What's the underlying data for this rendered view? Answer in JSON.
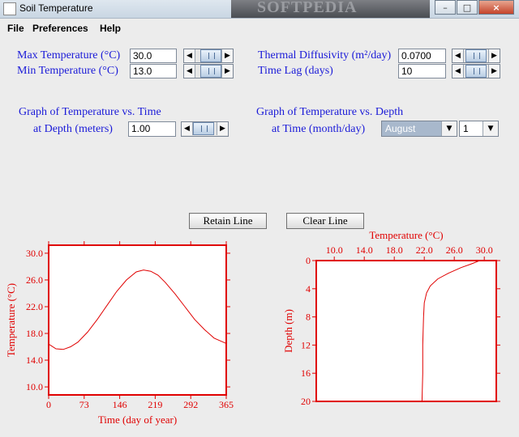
{
  "window": {
    "title": "Soil Temperature",
    "watermark": "SOFTPEDIA",
    "minimize": "–",
    "maximize": "□",
    "close": "×"
  },
  "menu": {
    "items": [
      "File",
      "Preferences",
      "Help"
    ]
  },
  "params": {
    "max_temp_label": "Max Temperature (°C)",
    "max_temp_value": "30.0",
    "min_temp_label": "Min Temperature (°C)",
    "min_temp_value": "13.0",
    "diffusivity_label": "Thermal Diffusivity (m²/day)",
    "diffusivity_value": "0.0700",
    "lag_label": "Time Lag (days)",
    "lag_value": "10"
  },
  "time_graph": {
    "heading": "Graph of Temperature vs. Time",
    "depth_label": "at Depth (meters)",
    "depth_value": "1.00"
  },
  "depth_graph": {
    "heading": "Graph of Temperature vs. Depth",
    "time_label": "at Time (month/day)",
    "month": "August",
    "day": "1"
  },
  "buttons": {
    "retain": "Retain Line",
    "clear": "Clear Line"
  },
  "colors": {
    "label_blue": "#1b1bd8",
    "plot_red": "#e00000"
  },
  "chart_data": [
    {
      "type": "line",
      "xlabel": "Time (day of year)",
      "ylabel": "Temperature (°C)",
      "xlim": [
        0,
        365
      ],
      "ylim": [
        8.8,
        31.2
      ],
      "xticks": [
        0,
        73,
        146,
        219,
        292,
        365
      ],
      "yticks": [
        10.0,
        14.0,
        18.0,
        22.0,
        26.0,
        30.0
      ],
      "x": [
        0,
        15,
        30,
        45,
        60,
        80,
        100,
        120,
        140,
        160,
        180,
        195,
        210,
        225,
        240,
        260,
        280,
        300,
        320,
        340,
        365
      ],
      "y": [
        16.4,
        15.7,
        15.6,
        16.0,
        16.7,
        18.2,
        20.1,
        22.2,
        24.3,
        26.0,
        27.2,
        27.5,
        27.3,
        26.7,
        25.6,
        23.9,
        22.0,
        20.1,
        18.6,
        17.3,
        16.5
      ]
    },
    {
      "type": "line",
      "xlabel": "Temperature (°C)",
      "ylabel": "Depth (m)",
      "xlim": [
        7.6,
        31.6
      ],
      "ylim": [
        0,
        20
      ],
      "xticks": [
        10.0,
        14.0,
        18.0,
        22.0,
        26.0,
        30.0
      ],
      "yticks": [
        0,
        4,
        8,
        12,
        16,
        20
      ],
      "x": [
        29.4,
        28.2,
        26.9,
        25.2,
        23.8,
        22.8,
        22.3,
        22.0,
        21.9,
        21.8,
        21.8,
        21.7
      ],
      "y": [
        0,
        0.5,
        1.0,
        1.8,
        2.6,
        3.6,
        4.6,
        6.0,
        8.0,
        12.0,
        16.0,
        20.0
      ]
    }
  ]
}
